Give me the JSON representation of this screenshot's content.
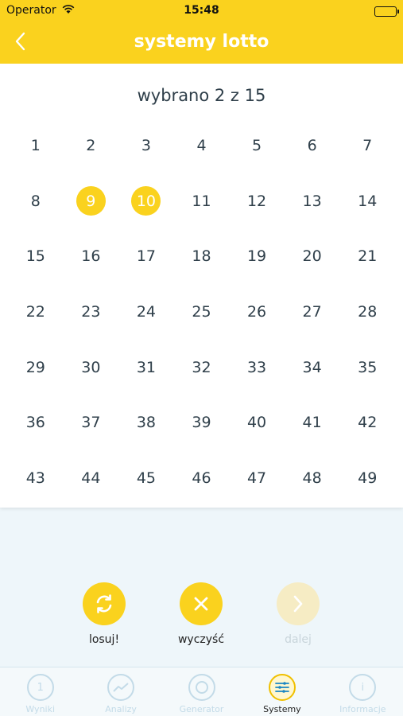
{
  "status_bar": {
    "carrier": "Operator",
    "time": "15:48"
  },
  "nav": {
    "title": "systemy lotto",
    "back_icon": "chevron-left-icon"
  },
  "selection": {
    "text": "wybrano 2 z 15"
  },
  "numbers": [
    "1",
    "2",
    "3",
    "4",
    "5",
    "6",
    "7",
    "8",
    "9",
    "10",
    "11",
    "12",
    "13",
    "14",
    "15",
    "16",
    "17",
    "18",
    "19",
    "20",
    "21",
    "22",
    "23",
    "24",
    "25",
    "26",
    "27",
    "28",
    "29",
    "30",
    "31",
    "32",
    "33",
    "34",
    "35",
    "36",
    "37",
    "38",
    "39",
    "40",
    "41",
    "42",
    "43",
    "44",
    "45",
    "46",
    "47",
    "48",
    "49"
  ],
  "selected_numbers": [
    "9",
    "10"
  ],
  "actions": {
    "draw": {
      "label": "losuj!",
      "icon": "refresh-icon"
    },
    "clear": {
      "label": "wyczyść",
      "icon": "close-icon"
    },
    "next": {
      "label": "dalej",
      "icon": "chevron-right-icon",
      "enabled": false
    }
  },
  "tabs": [
    {
      "label": "Wyniki",
      "icon": "results-icon",
      "active": false
    },
    {
      "label": "Analizy",
      "icon": "analytics-icon",
      "active": false
    },
    {
      "label": "Generator",
      "icon": "generator-icon",
      "active": false
    },
    {
      "label": "Systemy",
      "icon": "systems-icon",
      "active": true
    },
    {
      "label": "Informacje",
      "icon": "info-icon",
      "active": false
    }
  ],
  "colors": {
    "accent": "#fad21e",
    "text": "#2f3f4a",
    "tab_inactive": "#c3dbe8",
    "background": "#eef6fa"
  }
}
